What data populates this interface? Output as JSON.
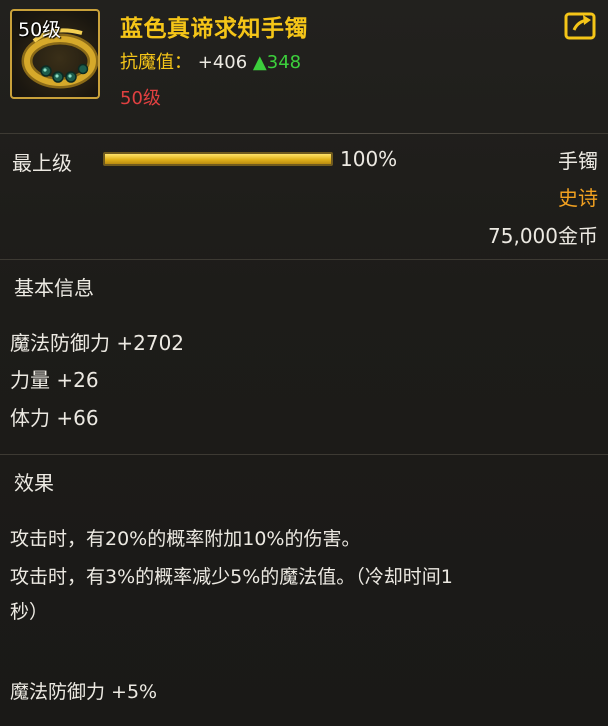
{
  "item": {
    "frame_level": "50级",
    "name": "蓝色真谛求知手镯",
    "resist_label": "抗魔值：",
    "resist_value": "+406",
    "resist_delta": "▲348",
    "required_level": "50级",
    "icon": "bracelet-icon",
    "share_icon": "share-external-icon"
  },
  "upgrade": {
    "label": "最上级",
    "percent_text": "100%",
    "progress": 1.0,
    "type": "手镯",
    "rarity": "史诗",
    "price": "75,000金币"
  },
  "basic_info": {
    "title": "基本信息",
    "stats": [
      "魔法防御力 +2702",
      "力量 +26",
      "体力 +66"
    ]
  },
  "effects": {
    "title": "效果",
    "lines": [
      "攻击时，有20%的概率附加10%的伤害。",
      "攻击时，有3%的概率减少5%的魔法值。（冷却时间1",
      "秒）",
      "魔法防御力 +5%"
    ]
  },
  "colors": {
    "title_gold": "#f5c518",
    "rarity_orange": "#f0a020",
    "level_red": "#e04040",
    "delta_green": "#3ccf3c",
    "background": "#1c1b19"
  }
}
